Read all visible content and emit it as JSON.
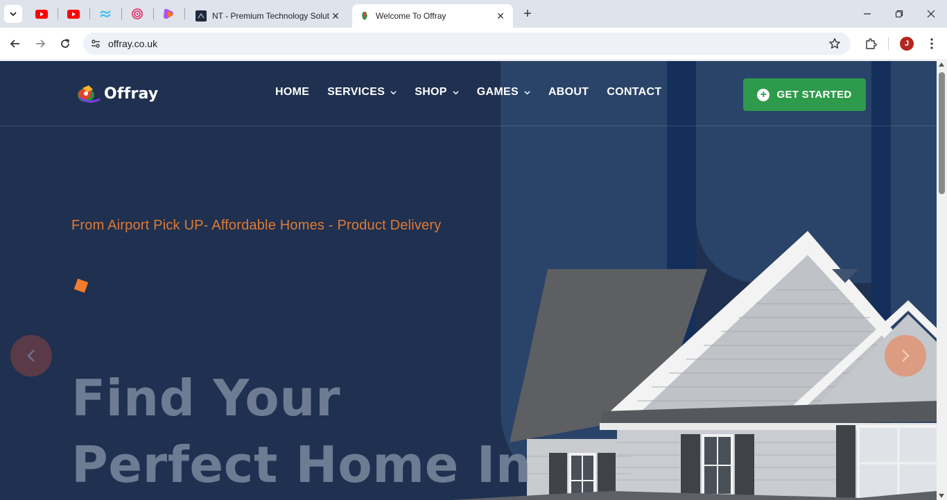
{
  "browser": {
    "tabs": [
      {
        "title": "NT - Premium Technology Solut",
        "active": false
      },
      {
        "title": "Welcome To Offray",
        "active": true
      }
    ],
    "address": "offray.co.uk",
    "profile_initial": "J",
    "pinned_icons": [
      "youtube-icon",
      "youtube-icon",
      "tailwind-icon",
      "spiral-icon",
      "heart-app-icon"
    ]
  },
  "site": {
    "brand": "Offray",
    "nav": [
      {
        "label": "HOME",
        "has_dropdown": false
      },
      {
        "label": "SERVICES",
        "has_dropdown": true
      },
      {
        "label": "SHOP",
        "has_dropdown": true
      },
      {
        "label": "GAMES",
        "has_dropdown": true
      },
      {
        "label": "ABOUT",
        "has_dropdown": false
      },
      {
        "label": "CONTACT",
        "has_dropdown": false
      }
    ],
    "cta_label": "GET STARTED"
  },
  "hero": {
    "tagline": "From Airport Pick UP- Affordable Homes - Product Delivery",
    "title_line1": "Find Your",
    "title_line2": "Perfect Home In"
  },
  "colors": {
    "page_bg": "#1f3050",
    "tagline": "#e07a32",
    "cta": "#2e9a4b",
    "accent_square": "#f47b2a"
  }
}
